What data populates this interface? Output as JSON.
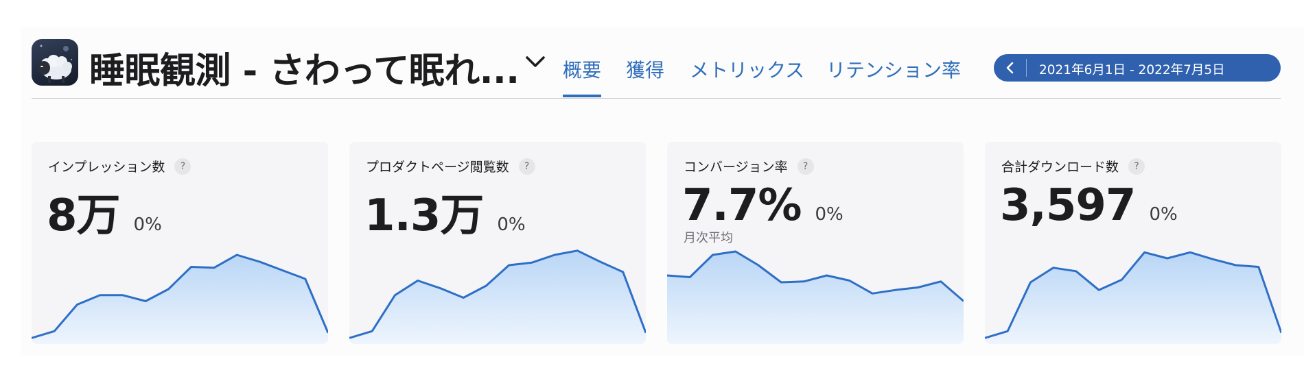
{
  "app": {
    "title": "睡眠観測 - さわって眠れ...",
    "icon": "sheep-app-icon",
    "dropdown_icon": "chevron-down-icon"
  },
  "tabs": [
    {
      "label": "概要",
      "active": true
    },
    {
      "label": "獲得",
      "active": false
    },
    {
      "label": "メトリックス",
      "active": false
    },
    {
      "label": "リテンション率",
      "active": false
    }
  ],
  "date_range": {
    "label": "2021年6月1日 - 2022年7月5日",
    "prev_icon": "chevron-left-icon"
  },
  "colors": {
    "accent": "#2f6ebb",
    "date_pill": "#2f61ae",
    "line": "#2e6fc6",
    "fill_top": "#b9d6f6",
    "fill_bottom": "#eef5fd"
  },
  "cards": [
    {
      "label": "インプレッション数",
      "help": "?",
      "value": "8万",
      "delta": "0%",
      "sub": ""
    },
    {
      "label": "プロダクトページ閲覧数",
      "help": "?",
      "value": "1.3万",
      "delta": "0%",
      "sub": ""
    },
    {
      "label": "コンバージョン率",
      "help": "?",
      "value": "7.7%",
      "delta": "0%",
      "sub": "月次平均"
    },
    {
      "label": "合計ダウンロード数",
      "help": "?",
      "value": "3,597",
      "delta": "0%",
      "sub": ""
    }
  ],
  "chart_data": [
    {
      "type": "area",
      "ylim": [
        0,
        1
      ],
      "values": [
        0.03,
        0.11,
        0.42,
        0.53,
        0.53,
        0.46,
        0.6,
        0.86,
        0.85,
        1.0,
        0.92,
        0.82,
        0.72,
        0.09
      ]
    },
    {
      "type": "area",
      "ylim": [
        0,
        1
      ],
      "values": [
        0.03,
        0.11,
        0.53,
        0.7,
        0.61,
        0.5,
        0.64,
        0.88,
        0.91,
        1.0,
        1.05,
        0.92,
        0.8,
        0.09
      ]
    },
    {
      "type": "area",
      "ylim": [
        0,
        1
      ],
      "values": [
        0.76,
        0.74,
        1.0,
        1.04,
        0.88,
        0.68,
        0.69,
        0.76,
        0.7,
        0.55,
        0.59,
        0.62,
        0.69,
        0.46
      ]
    },
    {
      "type": "area",
      "ylim": [
        0,
        1
      ],
      "values": [
        0.03,
        0.11,
        0.68,
        0.85,
        0.81,
        0.59,
        0.71,
        1.03,
        0.96,
        1.03,
        0.95,
        0.88,
        0.86,
        0.09
      ]
    }
  ]
}
